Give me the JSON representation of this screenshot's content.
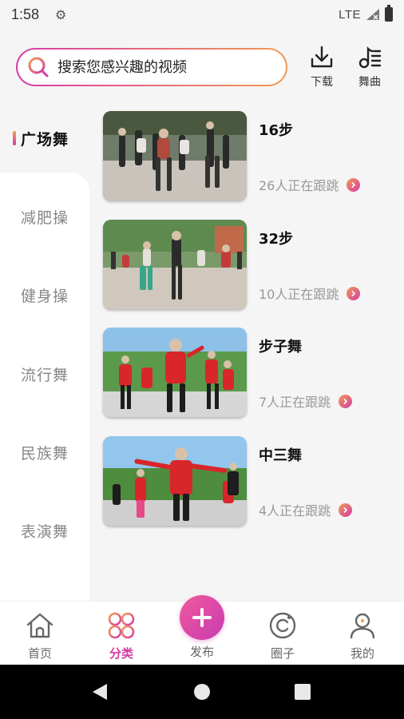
{
  "status_bar": {
    "time": "1:58",
    "network": "LTE"
  },
  "search": {
    "placeholder": "搜索您感兴趣的视频"
  },
  "header_buttons": {
    "download": "下载",
    "music": "舞曲"
  },
  "categories": [
    {
      "label": "广场舞",
      "active": true
    },
    {
      "label": "减肥操",
      "active": false
    },
    {
      "label": "健身操",
      "active": false
    },
    {
      "label": "流行舞",
      "active": false
    },
    {
      "label": "民族舞",
      "active": false
    },
    {
      "label": "表演舞",
      "active": false
    }
  ],
  "videos": [
    {
      "title": "16步",
      "followers": "26人正在跟跳"
    },
    {
      "title": "32步",
      "followers": "10人正在跟跳"
    },
    {
      "title": "步子舞",
      "followers": "7人正在跟跳"
    },
    {
      "title": "中三舞",
      "followers": "4人正在跟跳"
    }
  ],
  "bottom_nav": {
    "home": "首页",
    "category": "分类",
    "publish": "发布",
    "circle": "圈子",
    "mine": "我的"
  },
  "colors": {
    "accent_pink": "#d53ca6",
    "accent_orange": "#f29a52",
    "background": "#f5f5f6"
  }
}
